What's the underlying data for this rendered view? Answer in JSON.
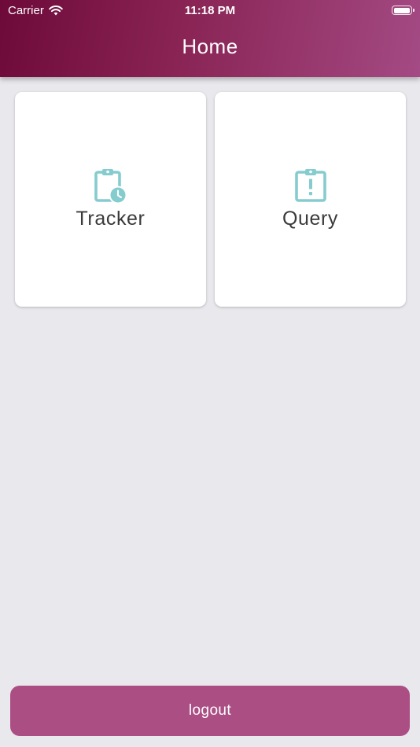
{
  "status_bar": {
    "carrier": "Carrier",
    "time": "11:18 PM",
    "wifi_icon": "wifi-icon",
    "battery_icon": "battery-icon"
  },
  "header": {
    "title": "Home"
  },
  "tiles": [
    {
      "label": "Tracker",
      "icon": "clipboard-clock-icon"
    },
    {
      "label": "Query",
      "icon": "clipboard-alert-icon"
    }
  ],
  "footer": {
    "logout_label": "logout"
  },
  "colors": {
    "header_gradient_start": "#6e0a3a",
    "header_gradient_end": "#a44a84",
    "icon_teal": "#85cccf",
    "logout_button": "#ab4e84",
    "background": "#e9e8ed"
  }
}
